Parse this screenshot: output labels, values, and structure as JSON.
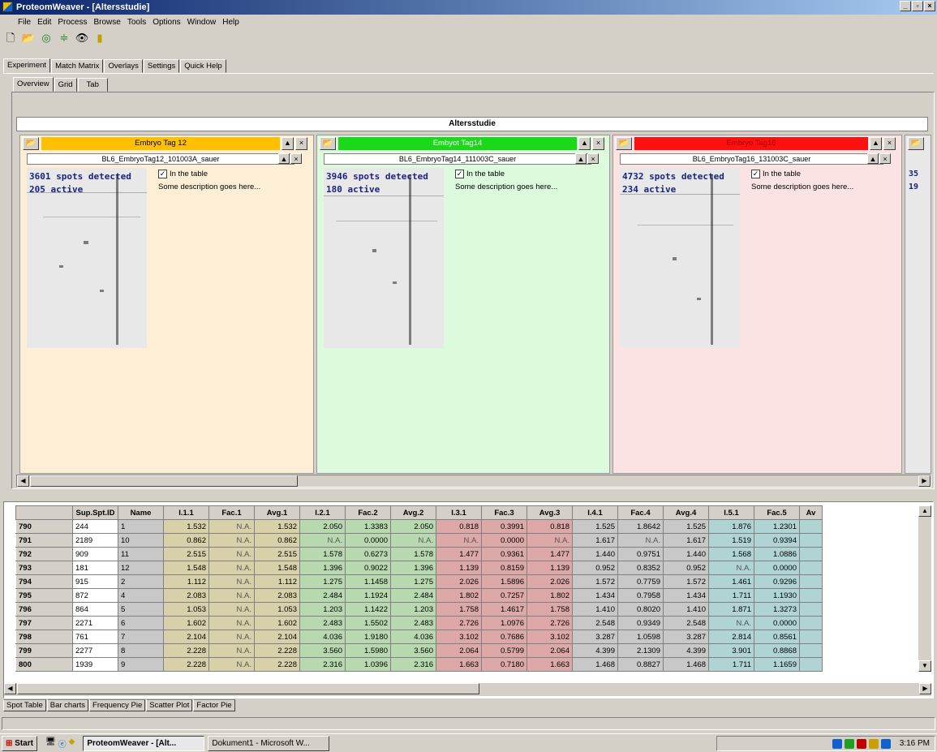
{
  "window": {
    "title": "ProteomWeaver - [Altersstudie]"
  },
  "menu": [
    "File",
    "Edit",
    "Process",
    "Browse",
    "Tools",
    "Options",
    "Window",
    "Help"
  ],
  "main_tabs": [
    "Experiment",
    "Match Matrix",
    "Overlays",
    "Settings",
    "Quick Help"
  ],
  "sub_tabs": [
    "Overview",
    "Grid",
    "Tab"
  ],
  "banner": "Altersstudie",
  "columns": [
    {
      "label": "Embryo Tag 12",
      "file": "BL6_EmbryoTag12_101003A_sauer",
      "spots": "3601 spots detected",
      "active": "205 active",
      "checkbox": "In the table",
      "description": "Some description goes here...",
      "header_color": "#ffc000",
      "bg_color": "#fdefd5"
    },
    {
      "label": "Embyot Tag14",
      "file": "BL6_EmbryoTag14_111003C_sauer",
      "spots": "3946 spots detected",
      "active": "180 active",
      "checkbox": "In the table",
      "description": "Some description goes here...",
      "header_color": "#19d919",
      "bg_color": "#dcfadc"
    },
    {
      "label": "Embryo Tag16",
      "file": "BL6_EmbryoTag16_131003C_sauer",
      "spots": "4732 spots detected",
      "active": "234 active",
      "checkbox": "In the table",
      "description": "Some description goes here...",
      "header_color": "#ff1010",
      "bg_color": "#fbe3e3"
    }
  ],
  "partial_column": {
    "spots": "35",
    "active": "19"
  },
  "table": {
    "headers": [
      "",
      "Sup.Spt.ID",
      "Name",
      "I.1.1",
      "Fac.1",
      "Avg.1",
      "I.2.1",
      "Fac.2",
      "Avg.2",
      "I.3.1",
      "Fac.3",
      "Avg.3",
      "I.4.1",
      "Fac.4",
      "Avg.4",
      "I.5.1",
      "Fac.5",
      "Av"
    ],
    "rows": [
      [
        "790",
        "244",
        "1",
        "1.532",
        "N.A.",
        "1.532",
        "2.050",
        "1.3383",
        "2.050",
        "0.818",
        "0.3991",
        "0.818",
        "1.525",
        "1.8642",
        "1.525",
        "1.876",
        "1.2301"
      ],
      [
        "791",
        "2189",
        "10",
        "0.862",
        "N.A.",
        "0.862",
        "N.A.",
        "0.0000",
        "N.A.",
        "N.A.",
        "0.0000",
        "N.A.",
        "1.617",
        "N.A.",
        "1.617",
        "1.519",
        "0.9394"
      ],
      [
        "792",
        "909",
        "11",
        "2.515",
        "N.A.",
        "2.515",
        "1.578",
        "0.6273",
        "1.578",
        "1.477",
        "0.9361",
        "1.477",
        "1.440",
        "0.9751",
        "1.440",
        "1.568",
        "1.0886"
      ],
      [
        "793",
        "181",
        "12",
        "1.548",
        "N.A.",
        "1.548",
        "1.396",
        "0.9022",
        "1.396",
        "1.139",
        "0.8159",
        "1.139",
        "0.952",
        "0.8352",
        "0.952",
        "N.A.",
        "0.0000"
      ],
      [
        "794",
        "915",
        "2",
        "1.112",
        "N.A.",
        "1.112",
        "1.275",
        "1.1458",
        "1.275",
        "2.026",
        "1.5896",
        "2.026",
        "1.572",
        "0.7759",
        "1.572",
        "1.461",
        "0.9296"
      ],
      [
        "795",
        "872",
        "4",
        "2.083",
        "N.A.",
        "2.083",
        "2.484",
        "1.1924",
        "2.484",
        "1.802",
        "0.7257",
        "1.802",
        "1.434",
        "0.7958",
        "1.434",
        "1.711",
        "1.1930"
      ],
      [
        "796",
        "864",
        "5",
        "1.053",
        "N.A.",
        "1.053",
        "1.203",
        "1.1422",
        "1.203",
        "1.758",
        "1.4617",
        "1.758",
        "1.410",
        "0.8020",
        "1.410",
        "1.871",
        "1.3273"
      ],
      [
        "797",
        "2271",
        "6",
        "1.602",
        "N.A.",
        "1.602",
        "2.483",
        "1.5502",
        "2.483",
        "2.726",
        "1.0976",
        "2.726",
        "2.548",
        "0.9349",
        "2.548",
        "N.A.",
        "0.0000"
      ],
      [
        "798",
        "761",
        "7",
        "2.104",
        "N.A.",
        "2.104",
        "4.036",
        "1.9180",
        "4.036",
        "3.102",
        "0.7686",
        "3.102",
        "3.287",
        "1.0598",
        "3.287",
        "2.814",
        "0.8561"
      ],
      [
        "799",
        "2277",
        "8",
        "2.228",
        "N.A.",
        "2.228",
        "3.560",
        "1.5980",
        "3.560",
        "2.064",
        "0.5799",
        "2.064",
        "4.399",
        "2.1309",
        "4.399",
        "3.901",
        "0.8868"
      ],
      [
        "800",
        "1939",
        "9",
        "2.228",
        "N.A.",
        "2.228",
        "2.316",
        "1.0396",
        "2.316",
        "1.663",
        "0.7180",
        "1.663",
        "1.468",
        "0.8827",
        "1.468",
        "1.711",
        "1.1659"
      ]
    ]
  },
  "bottom_tabs": [
    "Spot Table",
    "Bar charts",
    "Frequency Pie",
    "Scatter Plot",
    "Factor Pie"
  ],
  "taskbar": {
    "start": "Start",
    "tasks": [
      "ProteomWeaver - [Alt...",
      "Dokument1 - Microsoft W..."
    ],
    "clock": "3:16 PM"
  },
  "colors": {
    "yellow_cell": "#d8d0a8",
    "green_cell": "#b8d8b0",
    "red_cell": "#dca8a8",
    "gray_cell": "#c8c8c8",
    "teal_cell": "#b0d4d4"
  }
}
